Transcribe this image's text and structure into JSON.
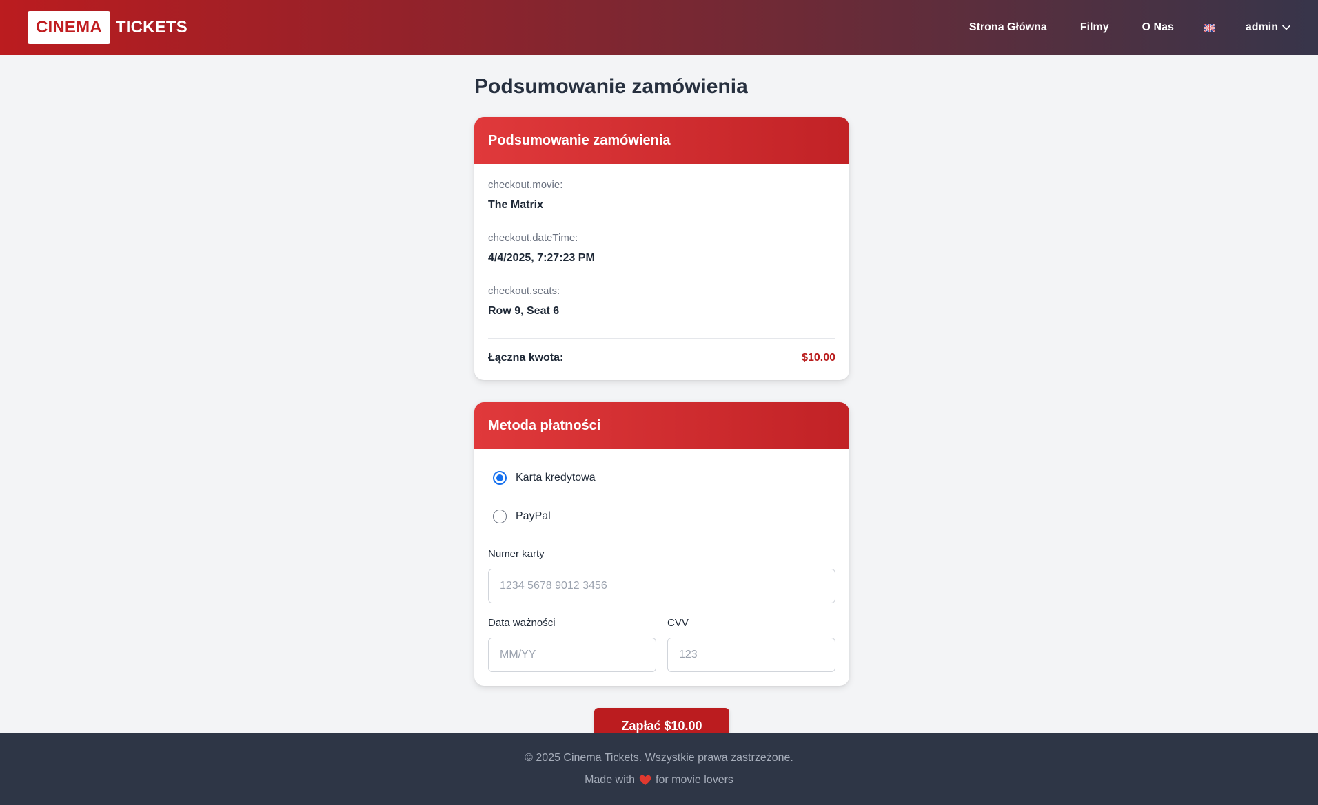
{
  "header": {
    "brand_box": "CINEMA",
    "brand_rest": "TICKETS",
    "nav": {
      "home": "Strona Główna",
      "movies": "Filmy",
      "about": "O Nas"
    },
    "language_icon": "uk-flag-icon",
    "user": "admin"
  },
  "page": {
    "title": "Podsumowanie zamówienia"
  },
  "summary": {
    "header": "Podsumowanie zamówienia",
    "movie_label": "checkout.movie:",
    "movie_value": "The Matrix",
    "datetime_label": "checkout.dateTime:",
    "datetime_value": "4/4/2025, 7:27:23 PM",
    "seats_label": "checkout.seats:",
    "seats_value": "Row 9, Seat 6",
    "total_label": "Łączna kwota:",
    "total_value": "$10.00"
  },
  "payment": {
    "header": "Metoda płatności",
    "options": [
      {
        "label": "Karta kredytowa",
        "selected": true
      },
      {
        "label": "PayPal",
        "selected": false
      }
    ],
    "card_number": {
      "label": "Numer karty",
      "placeholder": "1234 5678 9012 3456",
      "value": ""
    },
    "expiry": {
      "label": "Data ważności",
      "placeholder": "MM/YY",
      "value": ""
    },
    "cvv": {
      "label": "CVV",
      "placeholder": "123",
      "value": ""
    },
    "pay_button": "Zapłać $10.00"
  },
  "footer": {
    "copyright": "© 2025 Cinema Tickets. Wszystkie prawa zastrzeżone.",
    "made_before": "Made with",
    "made_after": "for movie lovers"
  },
  "colors": {
    "brand_red": "#bb1c1f",
    "price_red": "#b91c1c",
    "radio_blue": "#1570ef",
    "footer_bg": "#2e3646"
  }
}
